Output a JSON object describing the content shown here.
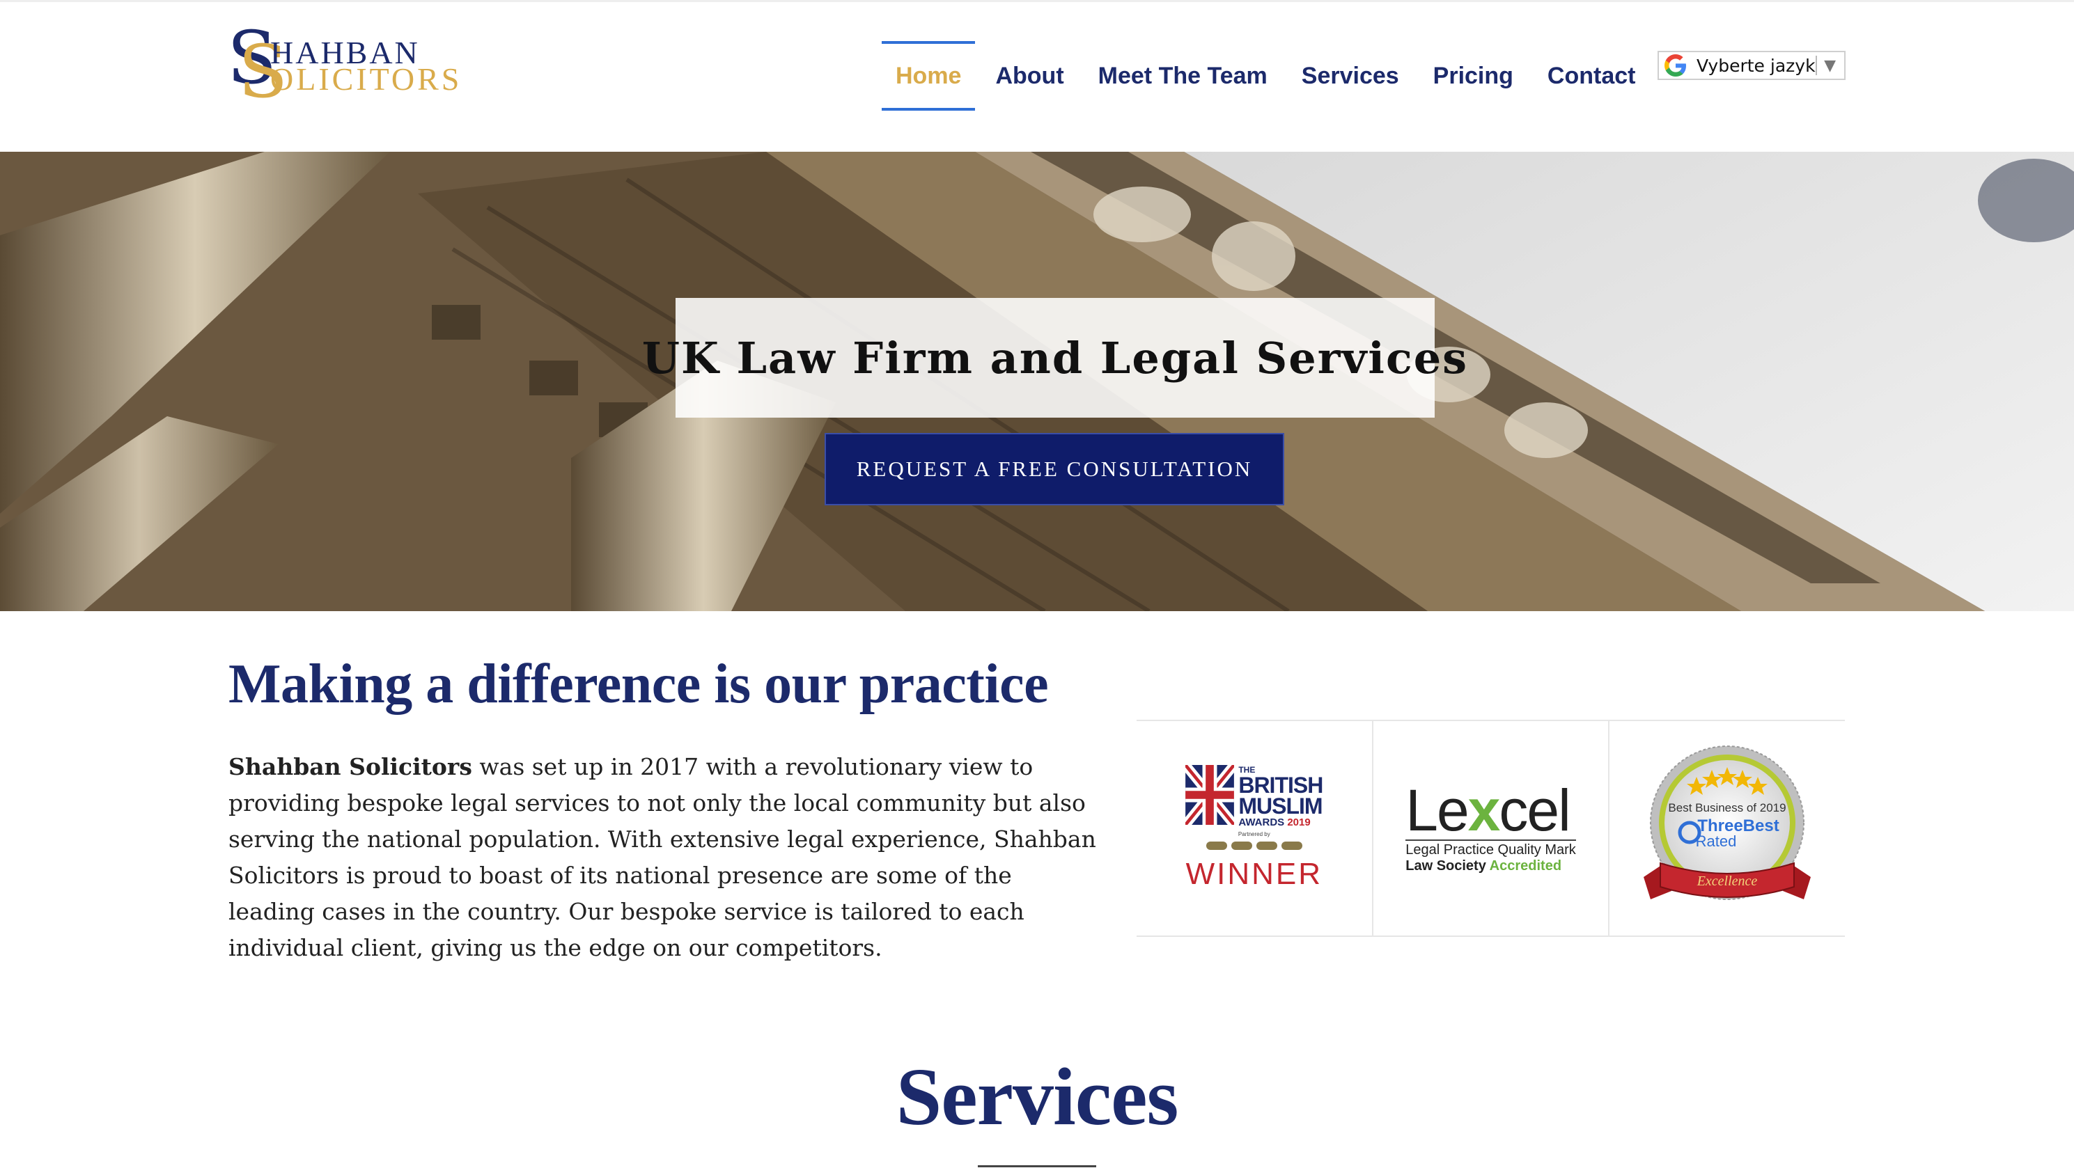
{
  "logo": {
    "initial": "S",
    "line1": "HAHBAN",
    "line2": "OLICITORS"
  },
  "nav": {
    "items": [
      {
        "label": "Home",
        "active": true
      },
      {
        "label": "About"
      },
      {
        "label": "Meet The Team"
      },
      {
        "label": "Services"
      },
      {
        "label": "Pricing"
      },
      {
        "label": "Contact"
      }
    ]
  },
  "language": {
    "label": "Vyberte jazyk",
    "arrow": "▼",
    "icon": "google-g-icon"
  },
  "hero": {
    "title": "UK Law Firm and Legal Services",
    "cta": "REQUEST A FREE CONSULTATION"
  },
  "intro": {
    "heading": "Making a difference is our practice",
    "firm": "Shahban Solicitors",
    "body": " was set up in 2017 with a revolutionary view to providing bespoke legal services to not only the local community but also serving the national population.  With extensive legal experience, Shahban Solicitors is proud to boast of its national presence are some of the leading cases in the country.  Our bespoke service is tailored to each individual client, giving us the edge on our competitors."
  },
  "awards": {
    "bma": {
      "line1": "THE",
      "line2": "BRITISH",
      "line3": "MUSLIM",
      "line4_a": "AWARDS",
      "line4_b": "2019",
      "partners": "Partnered by",
      "winner": "WINNER"
    },
    "lexcel": {
      "word_a": "Le",
      "word_b": "x",
      "word_c": "cel",
      "line1": "Legal Practice Quality Mark",
      "line2_a": "Law Society",
      "line2_b": "Accredited"
    },
    "threebest": {
      "line1": "Best Business of 2019",
      "line2": "ThreeBest",
      "line3": "Rated",
      "ribbon": "Excellence"
    }
  },
  "services": {
    "heading": "Services"
  },
  "colors": {
    "navy": "#1c2a6b",
    "gold": "#d9ab4b",
    "button": "#0f1c6a",
    "active_rule": "#2f6fd6"
  }
}
